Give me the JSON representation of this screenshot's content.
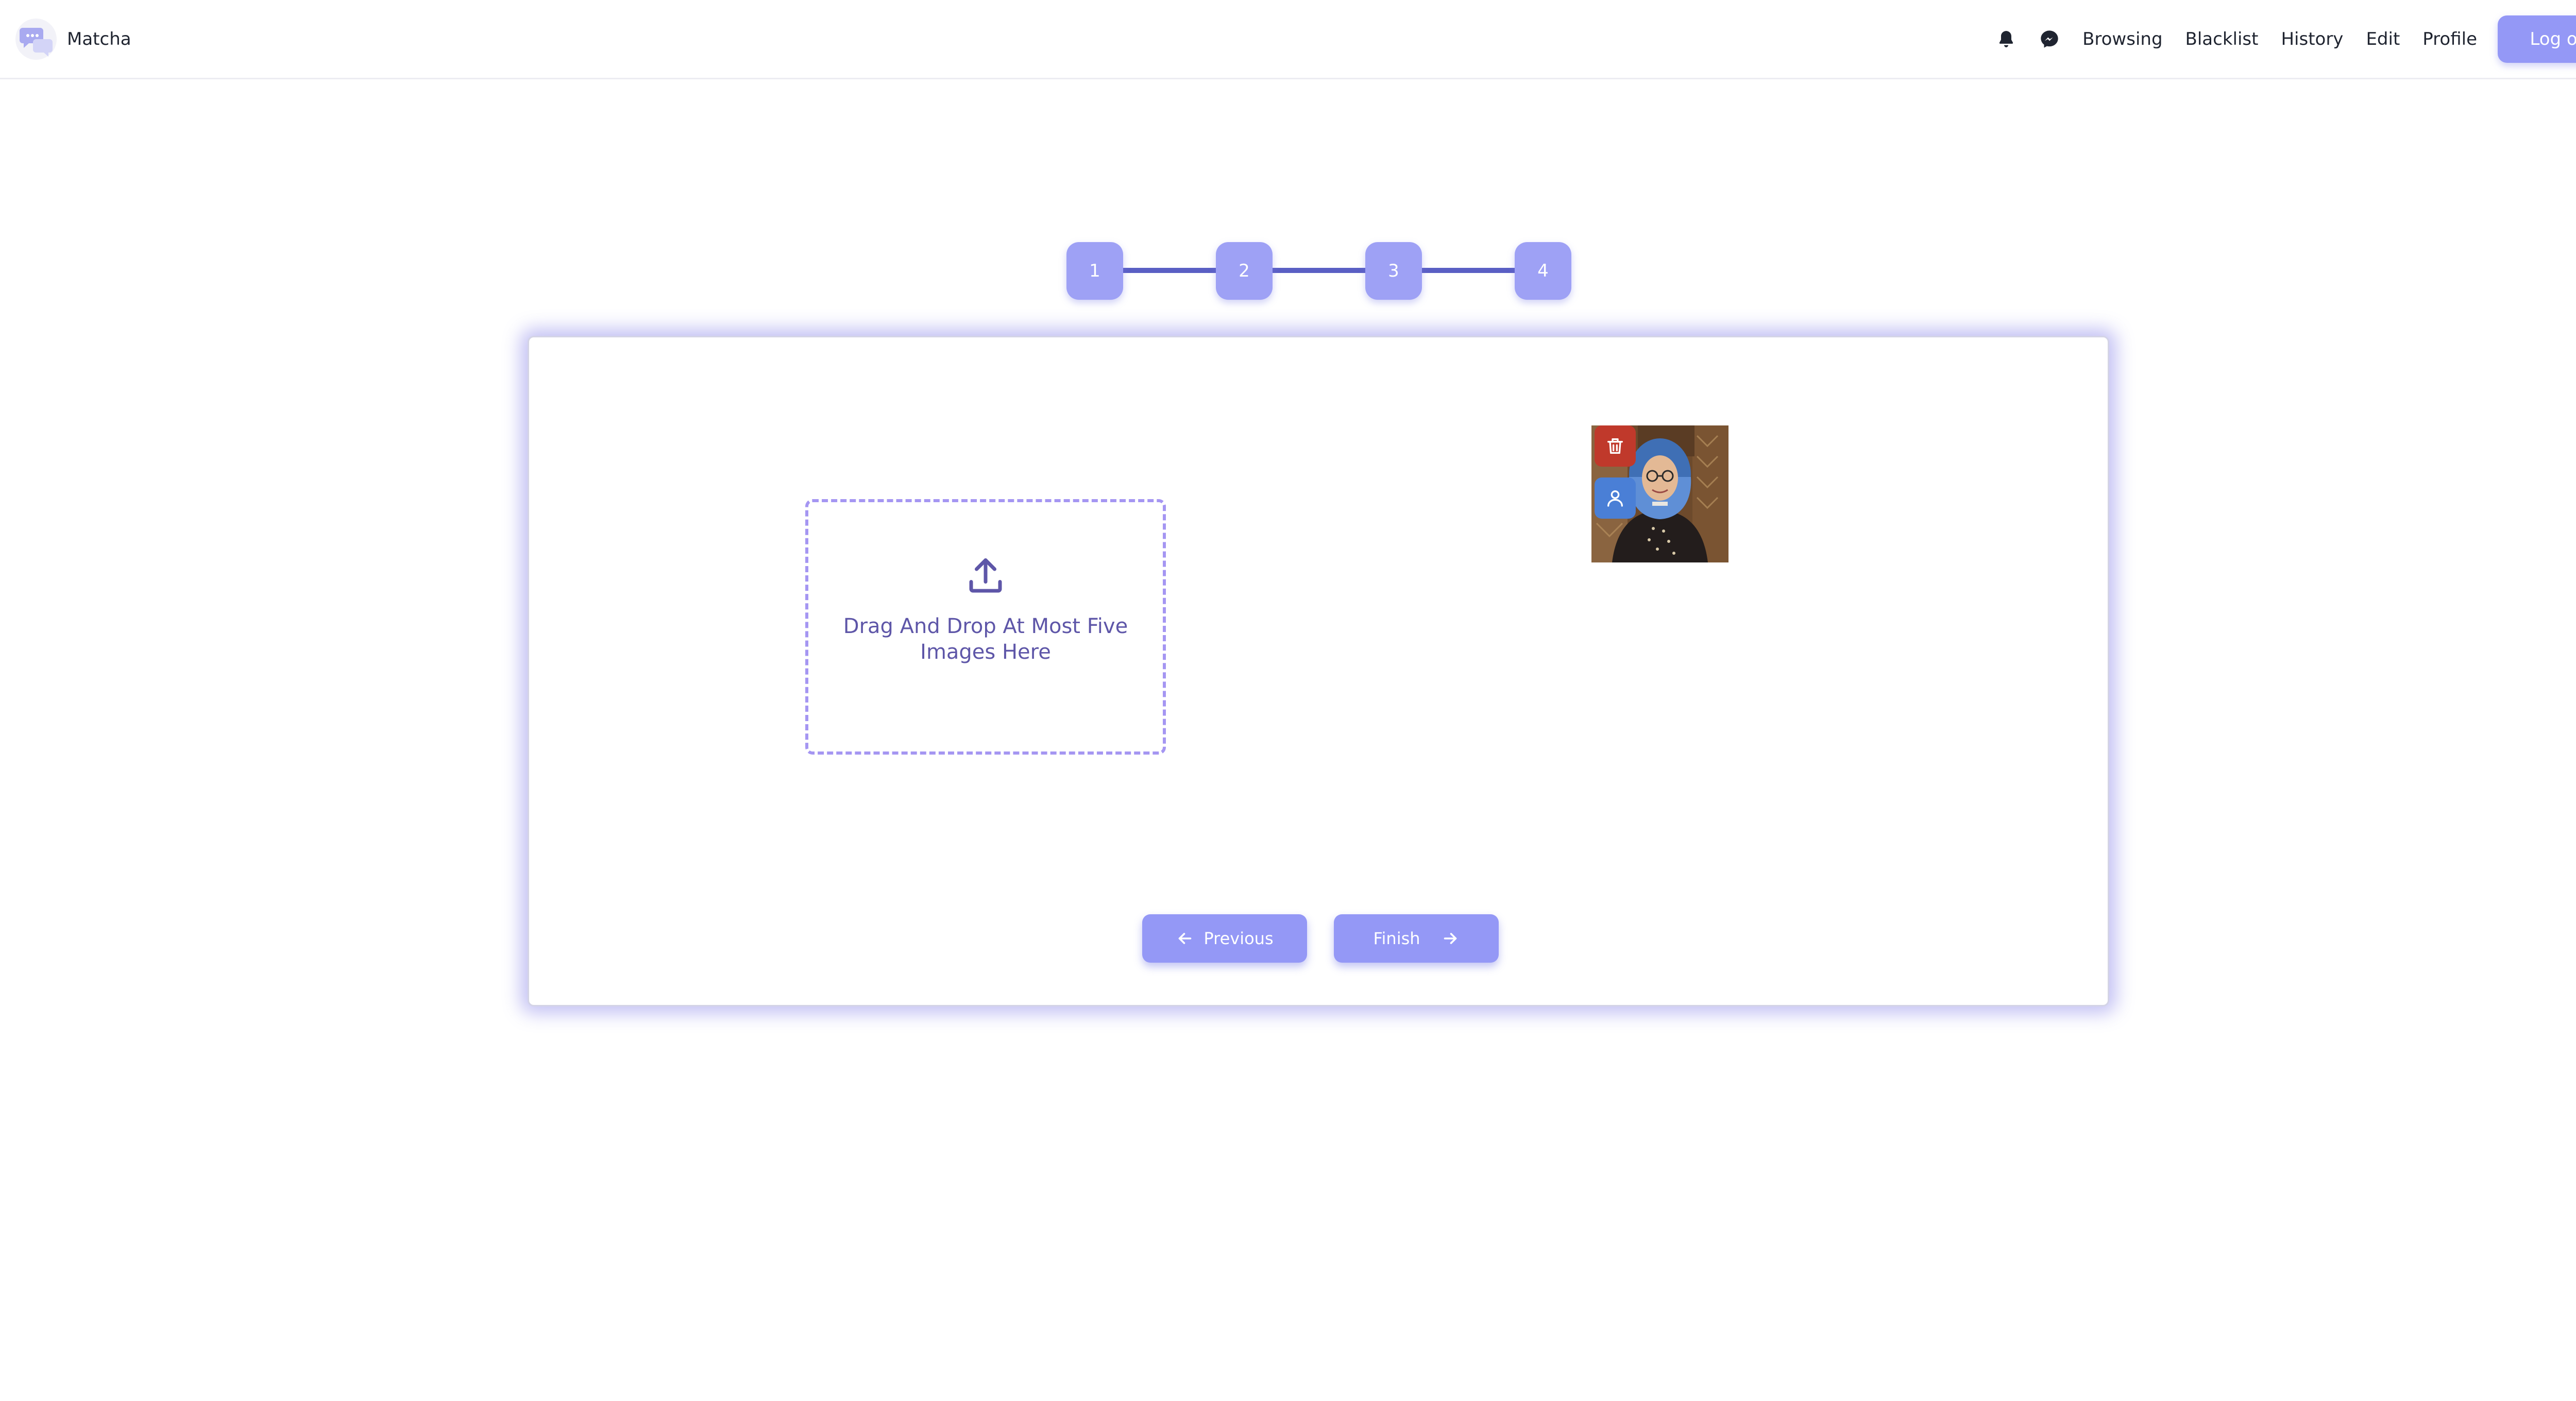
{
  "header": {
    "brand": "Matcha",
    "logo_icon": "chat-bubbles-logo-icon",
    "icons": [
      "bell-icon",
      "messenger-icon"
    ],
    "nav_links": [
      "Browsing",
      "Blacklist",
      "History",
      "Edit",
      "Profile"
    ],
    "logout_label": "Log out"
  },
  "stepper": {
    "steps": [
      "1",
      "2",
      "3",
      "4"
    ],
    "current_step": "4"
  },
  "upload": {
    "icon": "upload-icon",
    "dropzone_text": "Drag And Drop At Most Five Images Here",
    "images": [
      {
        "delete_icon": "trash-icon",
        "profile_icon": "user-icon"
      }
    ]
  },
  "actions": {
    "previous_label": "Previous",
    "finish_label": "Finish"
  },
  "colors": {
    "accent": "#9498f6",
    "step_line": "#5a5fc4",
    "dropzone_border": "#a596f2",
    "dropzone_text": "#5e56a8",
    "delete_button": "#c0392b",
    "profile_button": "#4a7fd6"
  }
}
